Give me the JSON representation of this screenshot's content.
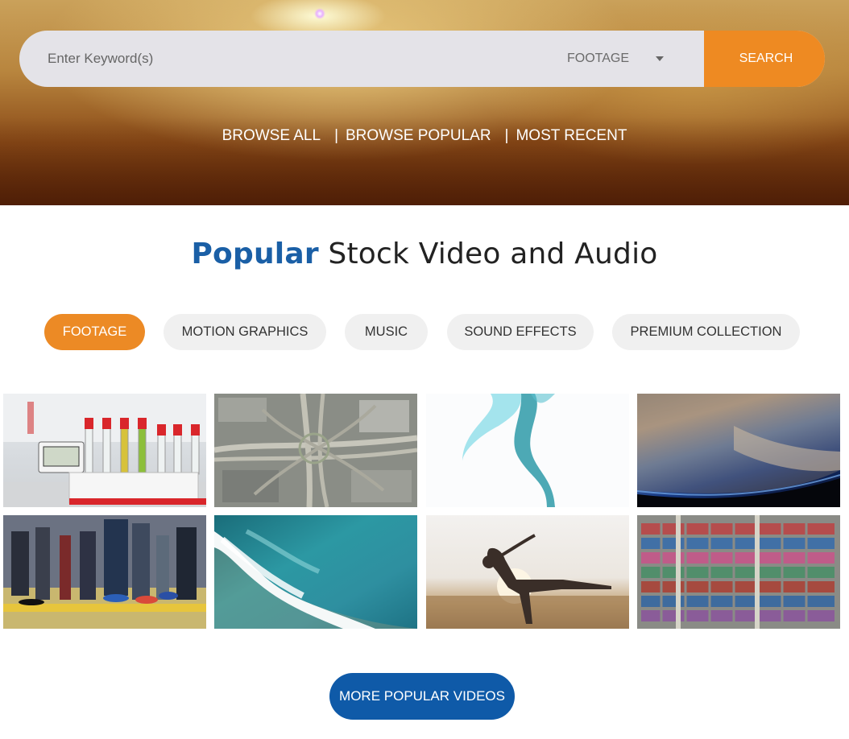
{
  "search": {
    "placeholder": "Enter Keyword(s)",
    "type_selected": "FOOTAGE",
    "button_label": "SEARCH"
  },
  "browse_nav": {
    "items": [
      "BROWSE ALL",
      "BROWSE POPULAR",
      "MOST RECENT"
    ],
    "separator": "|"
  },
  "heading": {
    "accent": "Popular",
    "rest": " Stock Video and Audio"
  },
  "filters": [
    "FOOTAGE",
    "MOTION GRAPHICS",
    "MUSIC",
    "SOUND EFFECTS",
    "PREMIUM COLLECTION"
  ],
  "more_button": "MORE POPULAR VIDEOS",
  "colors": {
    "accent_orange": "#ee8a22",
    "brand_blue": "#0f5aa8",
    "heading_blue": "#1a5fa6"
  }
}
